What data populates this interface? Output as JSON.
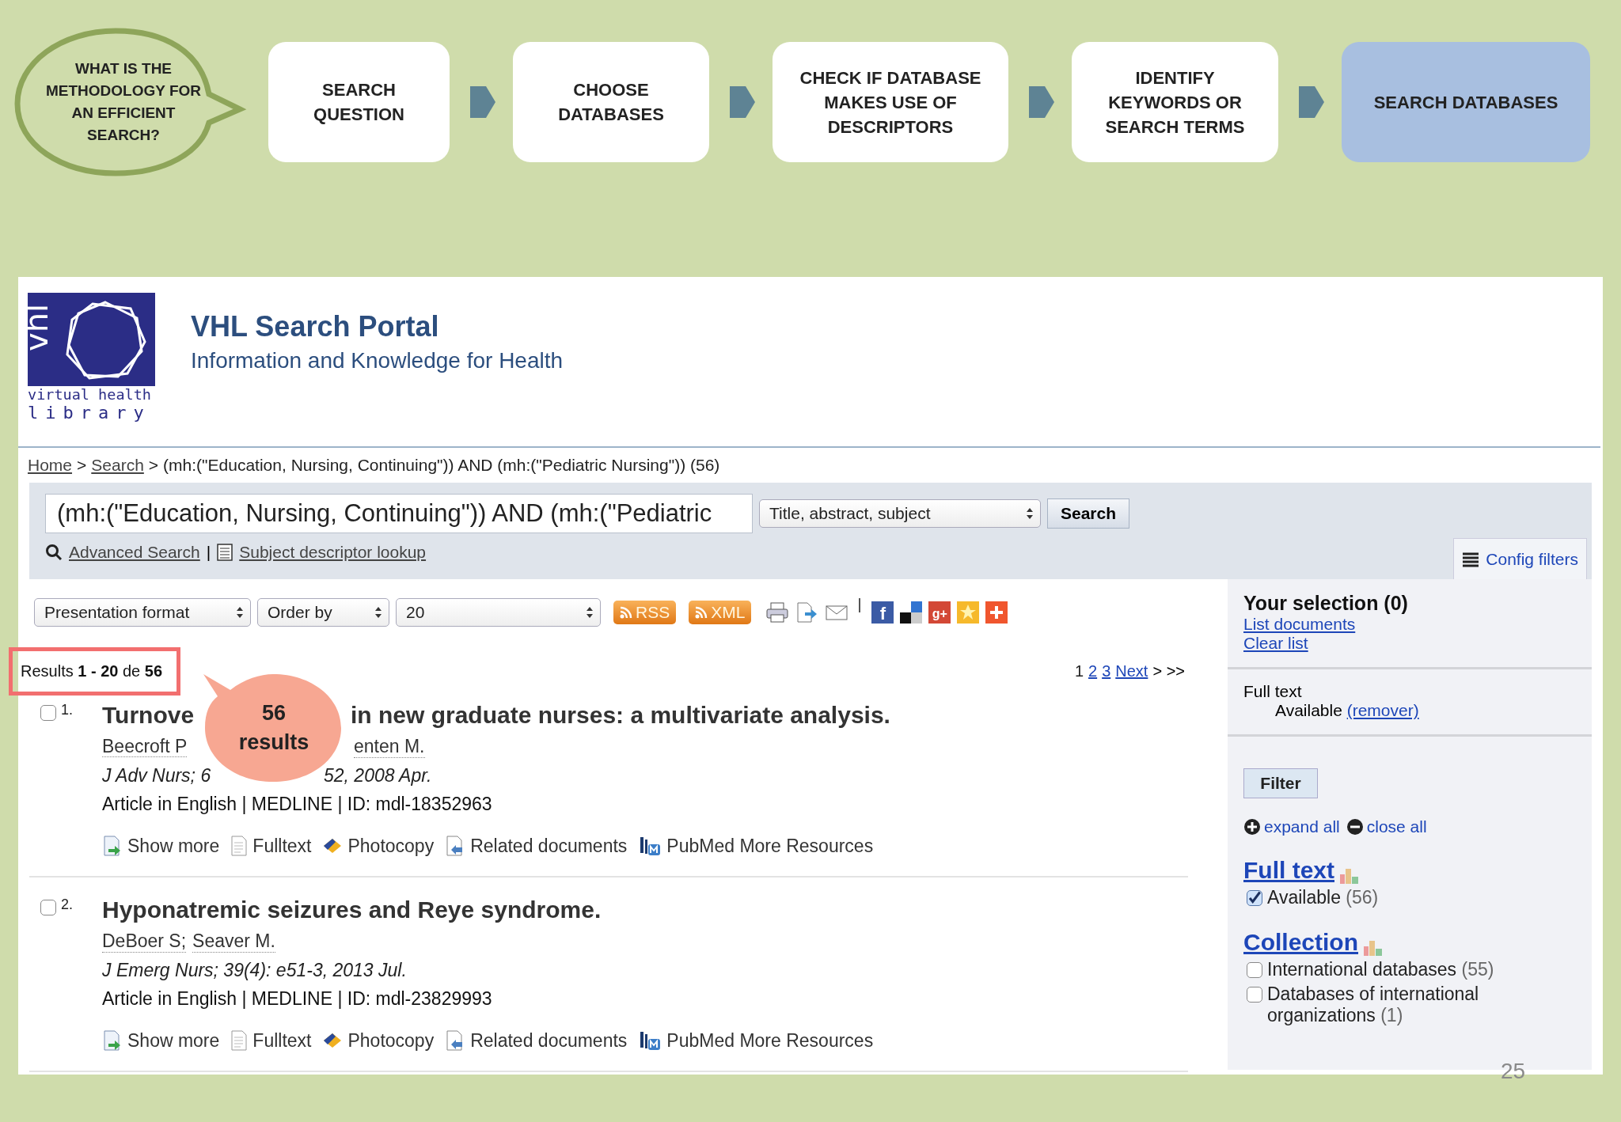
{
  "question_bubble": "WHAT IS THE METHODOLOGY FOR AN EFFICIENT SEARCH?",
  "steps": [
    {
      "label": "SEARCH QUESTION",
      "highlighted": false
    },
    {
      "label": "CHOOSE DATABASES",
      "highlighted": false
    },
    {
      "label": "CHECK IF DATABASE MAKES USE OF DESCRIPTORS",
      "highlighted": false
    },
    {
      "label": "IDENTIFY KEYWORDS OR SEARCH TERMS",
      "highlighted": false
    },
    {
      "label": "SEARCH DATABASES",
      "highlighted": true
    }
  ],
  "portal": {
    "logo": {
      "mark": "vhl",
      "line1": "virtual health",
      "line2": "library"
    },
    "title": "VHL Search Portal",
    "subtitle": "Information and Knowledge for Health",
    "breadcrumb": {
      "links": [
        "Home",
        "Search"
      ],
      "separator": ">",
      "current": "(mh:(\"Education, Nursing, Continuing\")) AND (mh:(\"Pediatric Nursing\")) (56)"
    },
    "search": {
      "value": "(mh:(\"Education, Nursing, Continuing\")) AND (mh:(\"Pediatric",
      "scope": "Title, abstract, subject",
      "button": "Search",
      "advanced": "Advanced Search",
      "separator": "|",
      "descriptor_lookup": "Subject descriptor lookup",
      "config_filters": "Config filters"
    },
    "toolbar": {
      "selects": [
        "Presentation format",
        "Order by",
        "20"
      ],
      "feeds": [
        "RSS",
        "XML"
      ],
      "share": [
        {
          "kind": "facebook",
          "glyph": "f"
        },
        {
          "kind": "delicious"
        },
        {
          "kind": "googleplus",
          "glyph": "g+"
        },
        {
          "kind": "favorite"
        },
        {
          "kind": "add"
        }
      ]
    },
    "results_count": "Results **1 - 20** de **56**",
    "pager": {
      "pages": [
        {
          "label": "1",
          "selected": true
        },
        {
          "label": "2",
          "selected": false
        },
        {
          "label": "3",
          "selected": false
        }
      ],
      "next": "Next",
      "more": "> >>"
    },
    "callout": "56 results",
    "results": [
      {
        "number": "1.",
        "checked": false,
        "covered": true,
        "title": [
          "Turnove",
          "in new graduate nurses: a multivariate analysis."
        ],
        "authors": [
          "Beecroft P",
          "enten M."
        ],
        "source": [
          "J Adv Nurs; 6",
          "52, 2008 Apr."
        ],
        "meta": "Article in English | MEDLINE | ID: mdl-18352963",
        "actions": [
          {
            "kind": "show_more",
            "label": "Show more"
          },
          {
            "kind": "fulltext",
            "label": "Fulltext"
          },
          {
            "kind": "photocopy",
            "label": "Photocopy"
          },
          {
            "kind": "related",
            "label": "Related documents"
          },
          {
            "kind": "pubmed",
            "label": "PubMed More Resources"
          }
        ]
      },
      {
        "number": "2.",
        "checked": false,
        "covered": false,
        "title": [
          "Hyponatremic seizures and Reye syndrome."
        ],
        "authors": [
          "DeBoer S;",
          "Seaver M."
        ],
        "source": [
          "J Emerg Nurs",
          "; 39(4): e51-3, 2013 Jul."
        ],
        "meta": "Article in English | MEDLINE | ID: mdl-23829993",
        "actions": [
          {
            "kind": "show_more",
            "label": "Show more"
          },
          {
            "kind": "fulltext",
            "label": "Fulltext"
          },
          {
            "kind": "photocopy",
            "label": "Photocopy"
          },
          {
            "kind": "related",
            "label": "Related documents"
          },
          {
            "kind": "pubmed",
            "label": "PubMed More Resources"
          }
        ]
      }
    ],
    "sidebar": {
      "selection_title": "Your selection (0)",
      "selection_links": [
        "List documents",
        "Clear list"
      ],
      "active_filter": {
        "group": "Full text",
        "value": "Available",
        "remove": "(remover)"
      },
      "filter_button": "Filter",
      "expand_all": "expand all",
      "close_all": "close all",
      "facets": [
        {
          "title": "Full text",
          "items": [
            {
              "label": "Available",
              "count": "(56)",
              "checked": true
            }
          ]
        },
        {
          "title": "Collection",
          "items": [
            {
              "label": "International databases",
              "count": "(55)",
              "checked": false
            },
            {
              "label": "Databases of international organizations",
              "count": "(1)",
              "checked": false
            }
          ]
        }
      ]
    }
  },
  "page_number": "25"
}
